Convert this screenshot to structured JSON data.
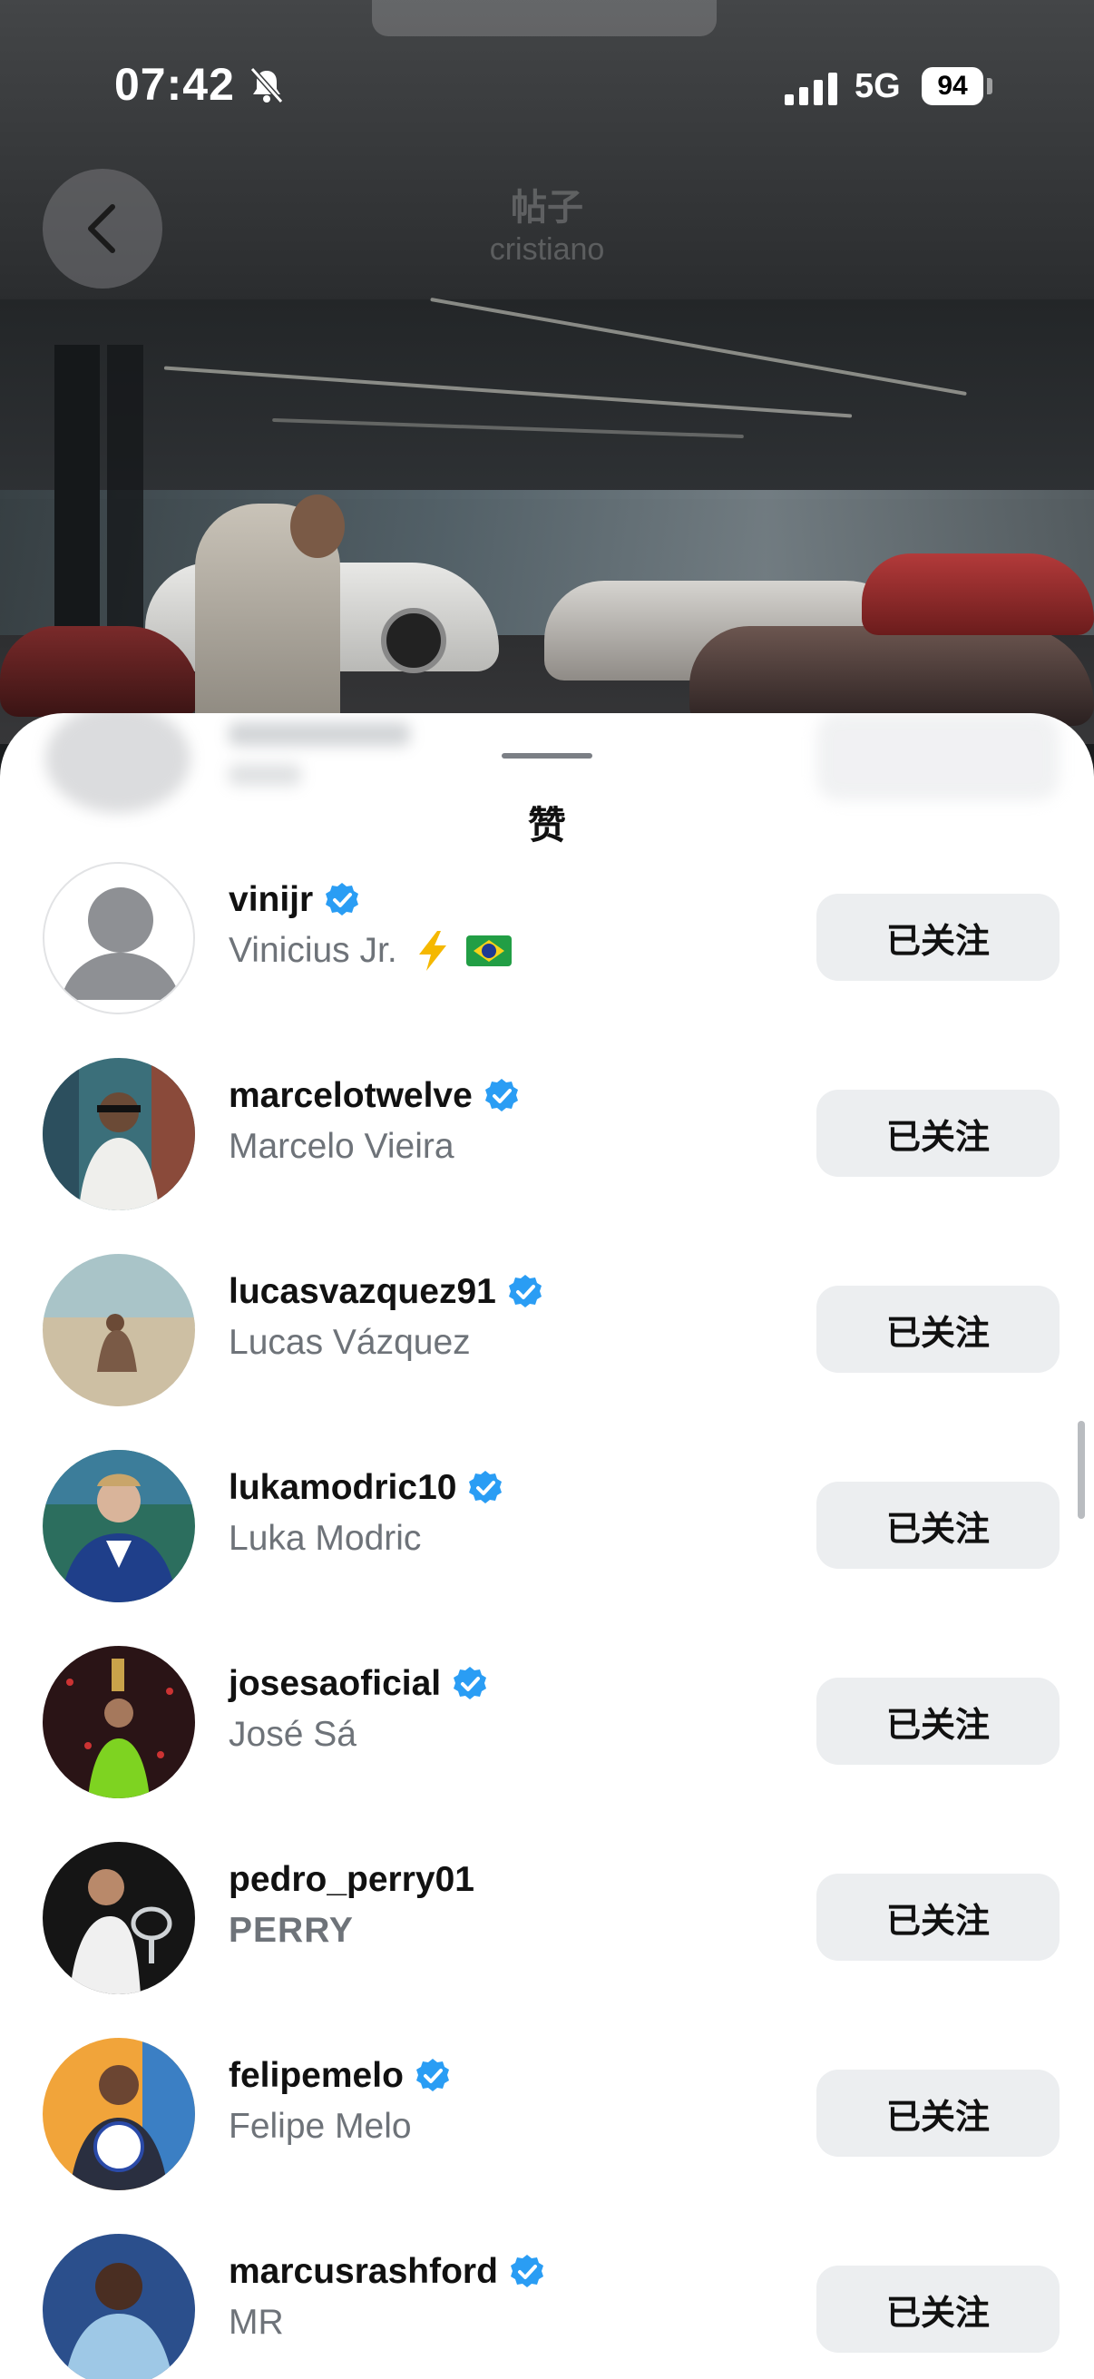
{
  "status_bar": {
    "time": "07:42",
    "network": "5G",
    "battery": "94"
  },
  "header": {
    "title": "帖子",
    "subtitle": "cristiano"
  },
  "sheet": {
    "title": "赞"
  },
  "likes": [
    {
      "username": "vinijr",
      "verified": true,
      "fullname": "Vinicius Jr.",
      "extra": [
        "lightning-emoji",
        "brazil-flag-emoji"
      ],
      "button": "已关注",
      "avatar": "default-avatar"
    },
    {
      "username": "marcelotwelve",
      "verified": true,
      "fullname": "Marcelo Vieira",
      "button": "已关注",
      "avatar": "photo"
    },
    {
      "username": "lucasvazquez91",
      "verified": true,
      "fullname": "Lucas Vázquez",
      "button": "已关注",
      "avatar": "photo"
    },
    {
      "username": "lukamodric10",
      "verified": true,
      "fullname": "Luka Modric",
      "button": "已关注",
      "avatar": "photo"
    },
    {
      "username": "josesaoficial",
      "verified": true,
      "fullname": "José Sá",
      "button": "已关注",
      "avatar": "photo"
    },
    {
      "username": "pedro_perry01",
      "verified": false,
      "fullname": "PERRY",
      "button": "已关注",
      "avatar": "photo"
    },
    {
      "username": "felipemelo",
      "verified": true,
      "fullname": "Felipe Melo",
      "button": "已关注",
      "avatar": "photo"
    },
    {
      "username": "marcusrashford",
      "verified": true,
      "fullname": "MR",
      "button": "已关注",
      "avatar": "photo"
    }
  ],
  "colors": {
    "verified_badge": "#2a9df4",
    "follow_button_bg": "#eceef0",
    "secondary_text": "#6e7379"
  }
}
